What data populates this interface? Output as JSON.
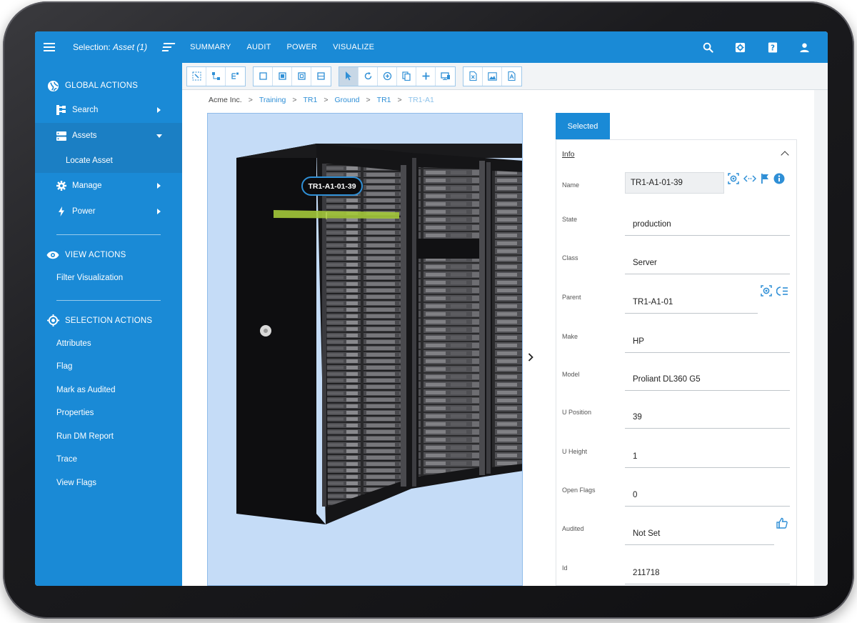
{
  "topbar": {
    "selection_prefix": "Selection:",
    "selection_value": "Asset (1)",
    "nav": [
      "SUMMARY",
      "AUDIT",
      "POWER",
      "VISUALIZE"
    ],
    "icons": [
      "search-icon",
      "settings-icon",
      "help-icon",
      "user-icon"
    ]
  },
  "sidebar": {
    "global_actions": "GLOBAL ACTIONS",
    "search": "Search",
    "assets": "Assets",
    "locate_asset": "Locate Asset",
    "manage": "Manage",
    "power": "Power",
    "view_actions": "VIEW ACTIONS",
    "filter_visualization": "Filter Visualization",
    "selection_actions": "SELECTION ACTIONS",
    "selection_items": [
      "Attributes",
      "Flag",
      "Mark as Audited",
      "Properties",
      "Run DM Report",
      "Trace",
      "View Flags"
    ]
  },
  "breadcrumb": [
    "Acme Inc.",
    "Training",
    "TR1",
    "Ground",
    "TR1",
    "TR1-A1"
  ],
  "viewport": {
    "asset_tag": "TR1-A1-01-39"
  },
  "panel": {
    "tab": "Selected",
    "section": "Info",
    "fields": [
      {
        "label": "Name",
        "value": "TR1-A1-01-39"
      },
      {
        "label": "State",
        "value": "production"
      },
      {
        "label": "Class",
        "value": "Server"
      },
      {
        "label": "Parent",
        "value": "TR1-A1-01"
      },
      {
        "label": "Make",
        "value": "HP"
      },
      {
        "label": "Model",
        "value": "Proliant DL360 G5"
      },
      {
        "label": "U Position",
        "value": "39"
      },
      {
        "label": "U Height",
        "value": "1"
      },
      {
        "label": "Open Flags",
        "value": "0"
      },
      {
        "label": "Audited",
        "value": "Not Set"
      },
      {
        "label": "Id",
        "value": "211718"
      }
    ]
  },
  "colors": {
    "primary": "#1a8ad6",
    "primary_dark": "#1b7fc4",
    "viewport_bg": "#c5dcf7",
    "highlight": "#a3c83a"
  }
}
